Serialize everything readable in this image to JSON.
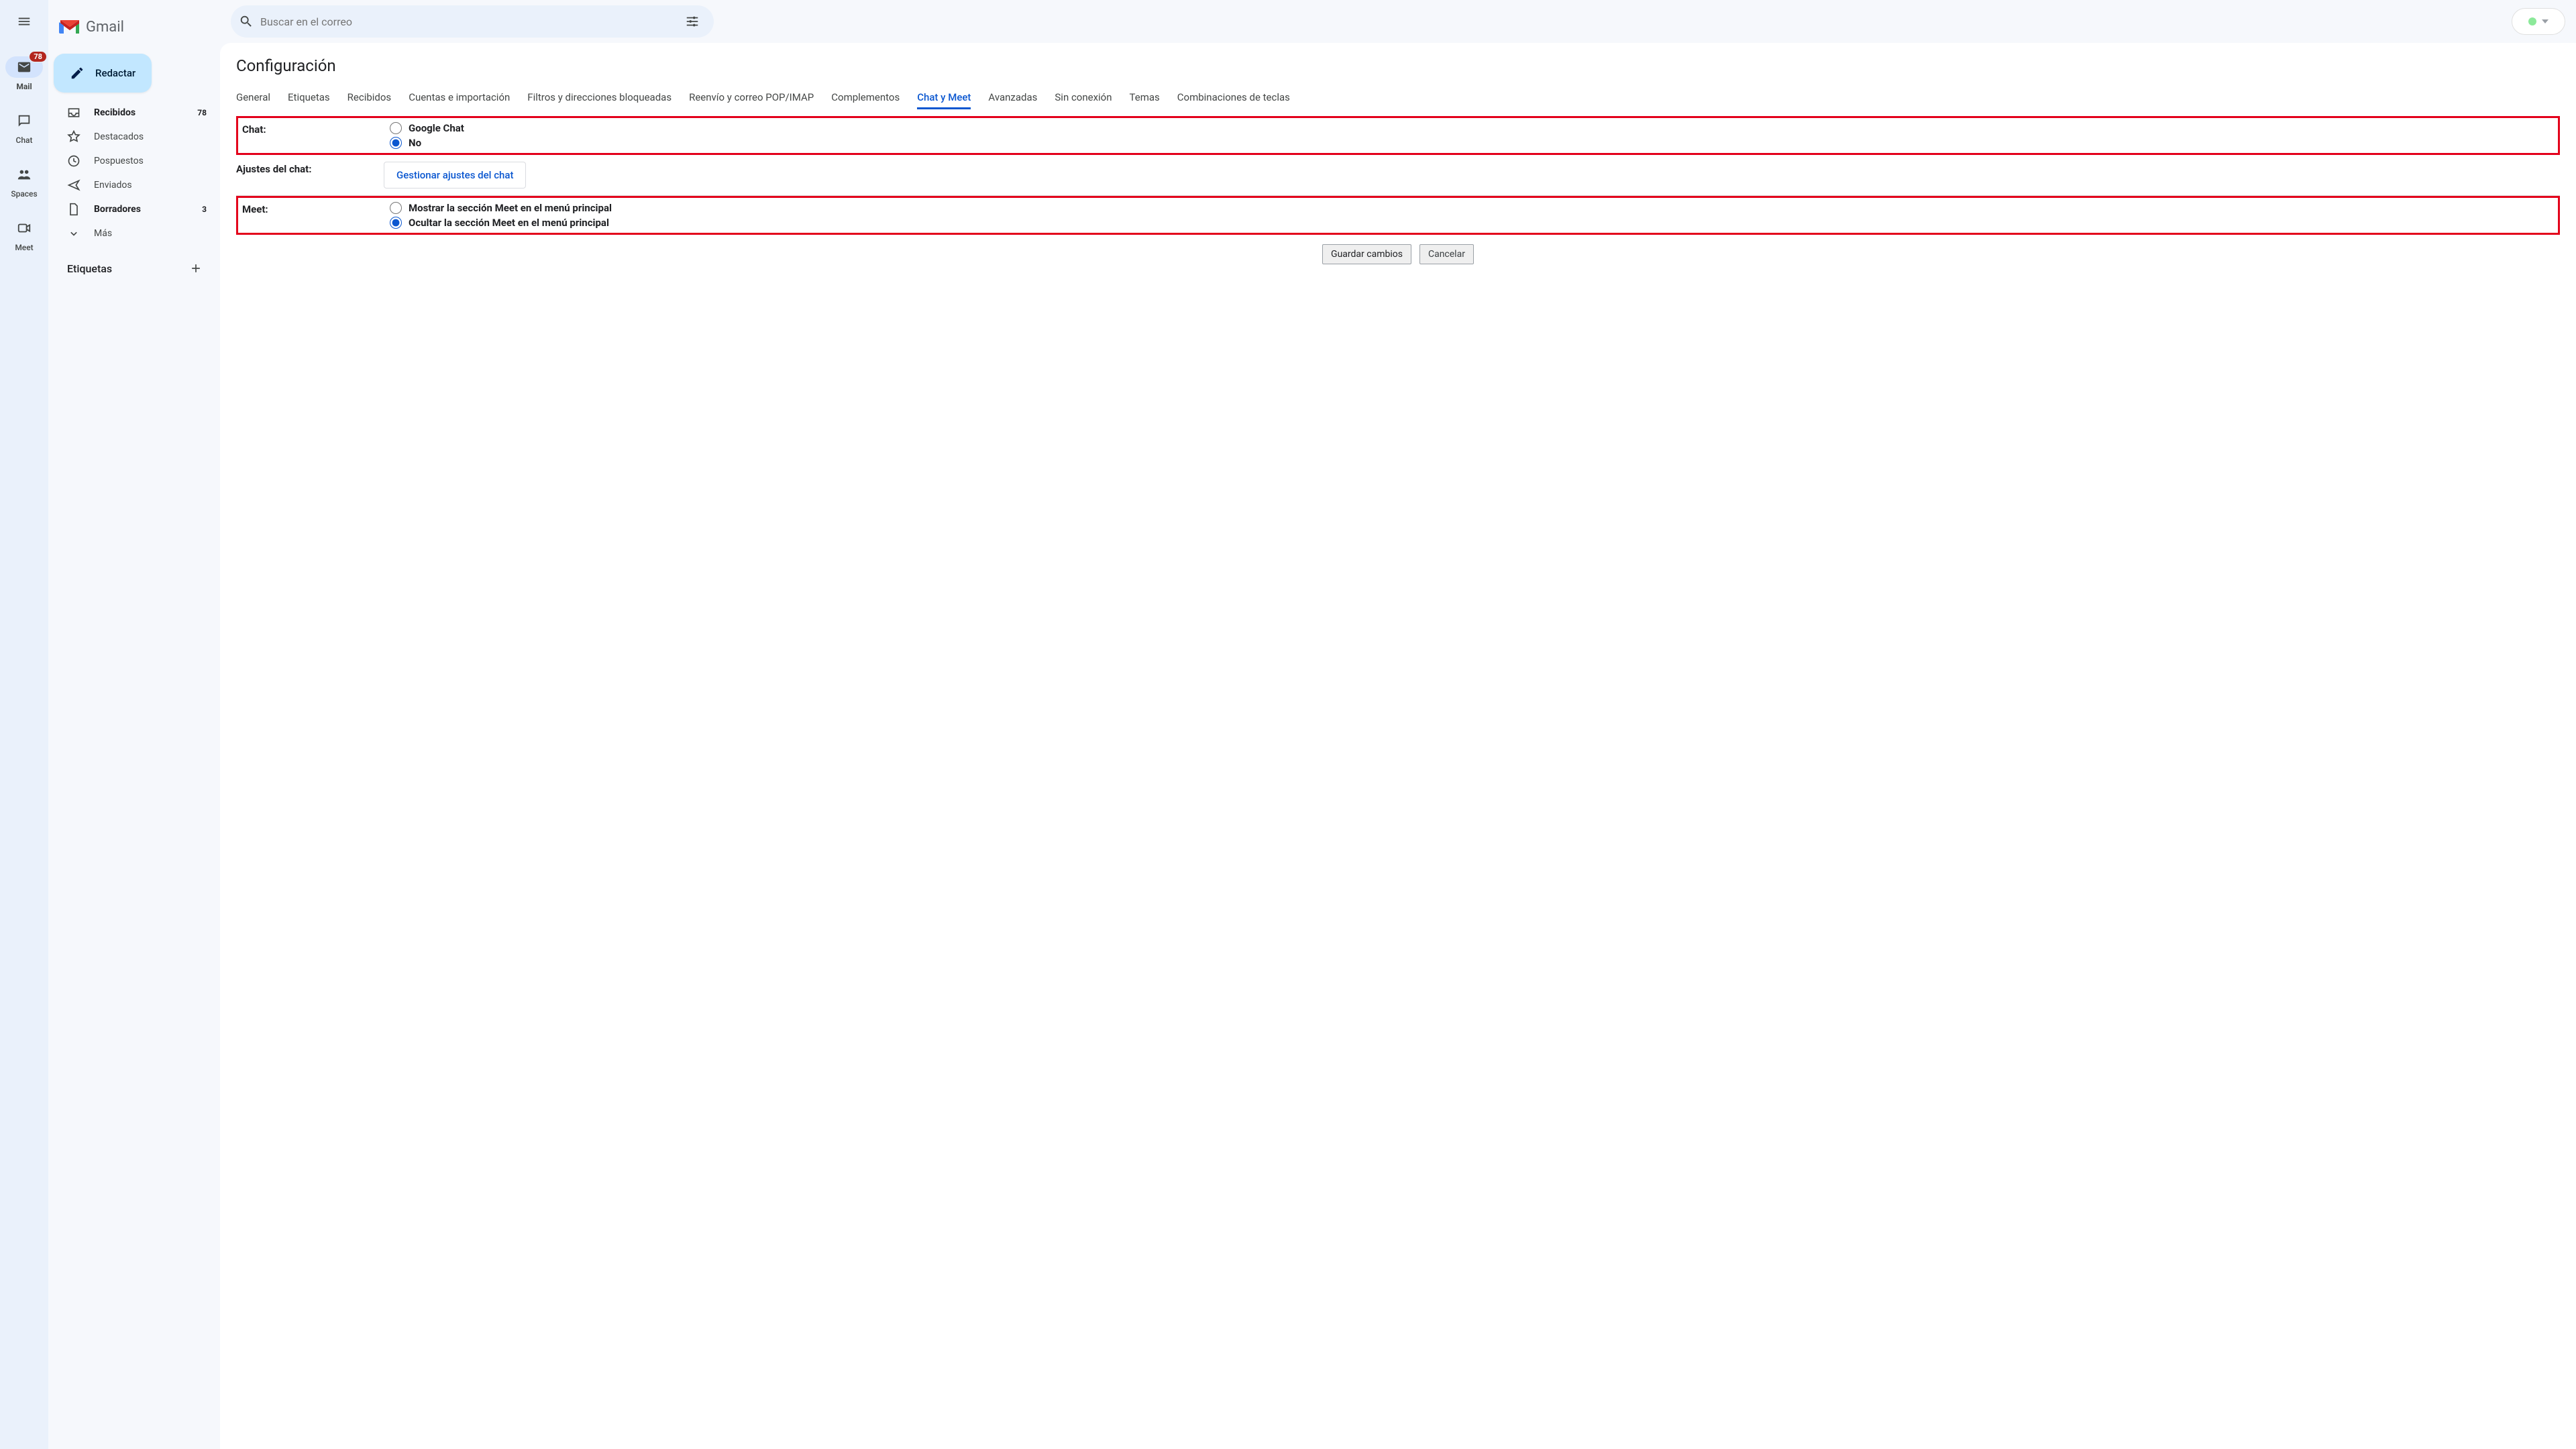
{
  "brand": {
    "name": "Gmail"
  },
  "search": {
    "placeholder": "Buscar en el correo"
  },
  "rail": {
    "items": [
      {
        "label": "Mail",
        "icon": "mail-icon",
        "badge": "78",
        "active": true
      },
      {
        "label": "Chat",
        "icon": "chat-icon",
        "badge": null,
        "active": false
      },
      {
        "label": "Spaces",
        "icon": "spaces-icon",
        "badge": null,
        "active": false
      },
      {
        "label": "Meet",
        "icon": "meet-icon",
        "badge": null,
        "active": false
      }
    ]
  },
  "compose": {
    "label": "Redactar"
  },
  "nav": {
    "items": [
      {
        "label": "Recibidos",
        "count": "78",
        "strong": true,
        "icon": "inbox-icon"
      },
      {
        "label": "Destacados",
        "count": "",
        "strong": false,
        "icon": "star-icon"
      },
      {
        "label": "Pospuestos",
        "count": "",
        "strong": false,
        "icon": "clock-icon"
      },
      {
        "label": "Enviados",
        "count": "",
        "strong": false,
        "icon": "send-icon"
      },
      {
        "label": "Borradores",
        "count": "3",
        "strong": true,
        "icon": "file-icon"
      },
      {
        "label": "Más",
        "count": "",
        "strong": false,
        "icon": "chevron-down-icon"
      }
    ],
    "labels_title": "Etiquetas"
  },
  "settings": {
    "title": "Configuración",
    "tabs": [
      "General",
      "Etiquetas",
      "Recibidos",
      "Cuentas e importación",
      "Filtros y direcciones bloqueadas",
      "Reenvío y correo POP/IMAP",
      "Complementos",
      "Chat y Meet",
      "Avanzadas",
      "Sin conexión",
      "Temas",
      "Combinaciones de teclas"
    ],
    "active_tab": "Chat y Meet",
    "chat": {
      "label": "Chat:",
      "options": [
        "Google Chat",
        "No"
      ],
      "selected": "No"
    },
    "chat_settings": {
      "label": "Ajustes del chat:",
      "button": "Gestionar ajustes del chat"
    },
    "meet": {
      "label": "Meet:",
      "options": [
        "Mostrar la sección Meet en el menú principal",
        "Ocultar la sección Meet en el menú principal"
      ],
      "selected": "Ocultar la sección Meet en el menú principal"
    },
    "actions": {
      "save": "Guardar cambios",
      "cancel": "Cancelar"
    }
  },
  "colors": {
    "accent": "#0b57d0",
    "highlight_box": "#e3001b"
  }
}
